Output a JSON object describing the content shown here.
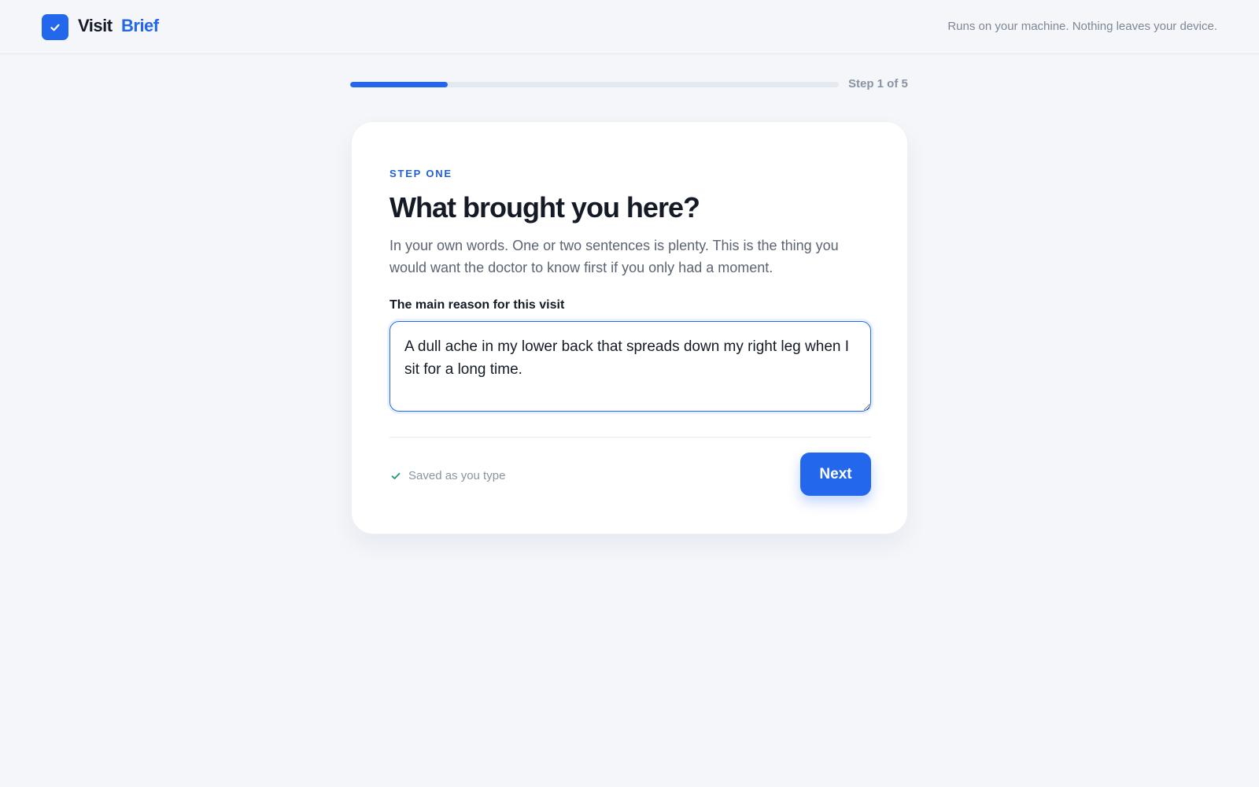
{
  "header": {
    "brand_first": "Visit",
    "brand_second": "Brief",
    "tagline": "Runs on your machine. Nothing leaves your device."
  },
  "progress": {
    "fraction": 0.2,
    "label": "Step 1 of 5"
  },
  "card": {
    "eyebrow": "STEP ONE",
    "title": "What brought you here?",
    "description": "In your own words. One or two sentences is plenty. This is the thing you would want the doctor to know first if you only had a moment.",
    "field_label": "The main reason for this visit",
    "field_value": "A dull ache in my lower back that spreads down my right leg when I sit for a long time.",
    "saved_status": "Saved as you type",
    "next_label": "Next"
  },
  "icons": {
    "logo": "check-icon",
    "saved": "check-icon"
  },
  "colors": {
    "accent": "#2368ec",
    "eyebrow": "#1f5fd6",
    "success": "#1f9d6b",
    "background": "#f4f6fa"
  }
}
